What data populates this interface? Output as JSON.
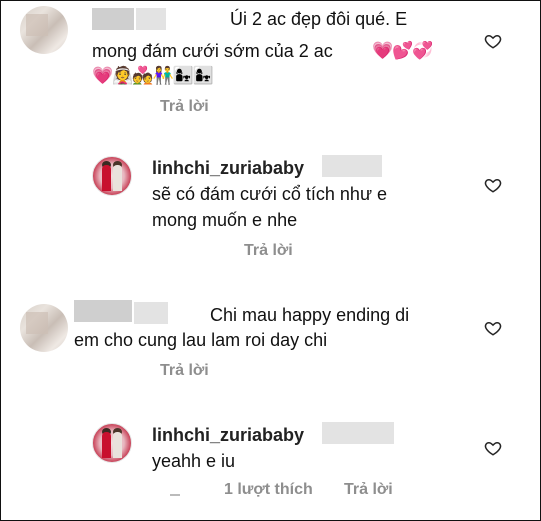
{
  "comments": [
    {
      "line1": "Úi 2 ac đẹp đôi qué. E",
      "line2_text": "mong đám cưới sớm của 2 ac",
      "line2_emoji": "💗💕💞",
      "line3_emoji": "💗👰💑👫👩‍👧👩‍👧",
      "reply_label": "Trả lời"
    },
    {
      "username": "linhchi_zuriababy",
      "line1": "sẽ có đám cưới cổ tích như e",
      "line2": "mong muốn e nhe",
      "reply_label": "Trả lời"
    },
    {
      "line1": "Chi mau happy ending di",
      "line2": "em cho cung lau lam roi day chi",
      "reply_label": "Trả lời"
    },
    {
      "username": "linhchi_zuriababy",
      "line1": "yeahh e iu",
      "likes_label": "1 lượt thích",
      "reply_label": "Trả lời"
    }
  ],
  "icons": {
    "like": "heart-outline-icon"
  },
  "colors": {
    "text": "#111111",
    "meta": "#8e8e8e",
    "heart_stroke": "#262626"
  }
}
